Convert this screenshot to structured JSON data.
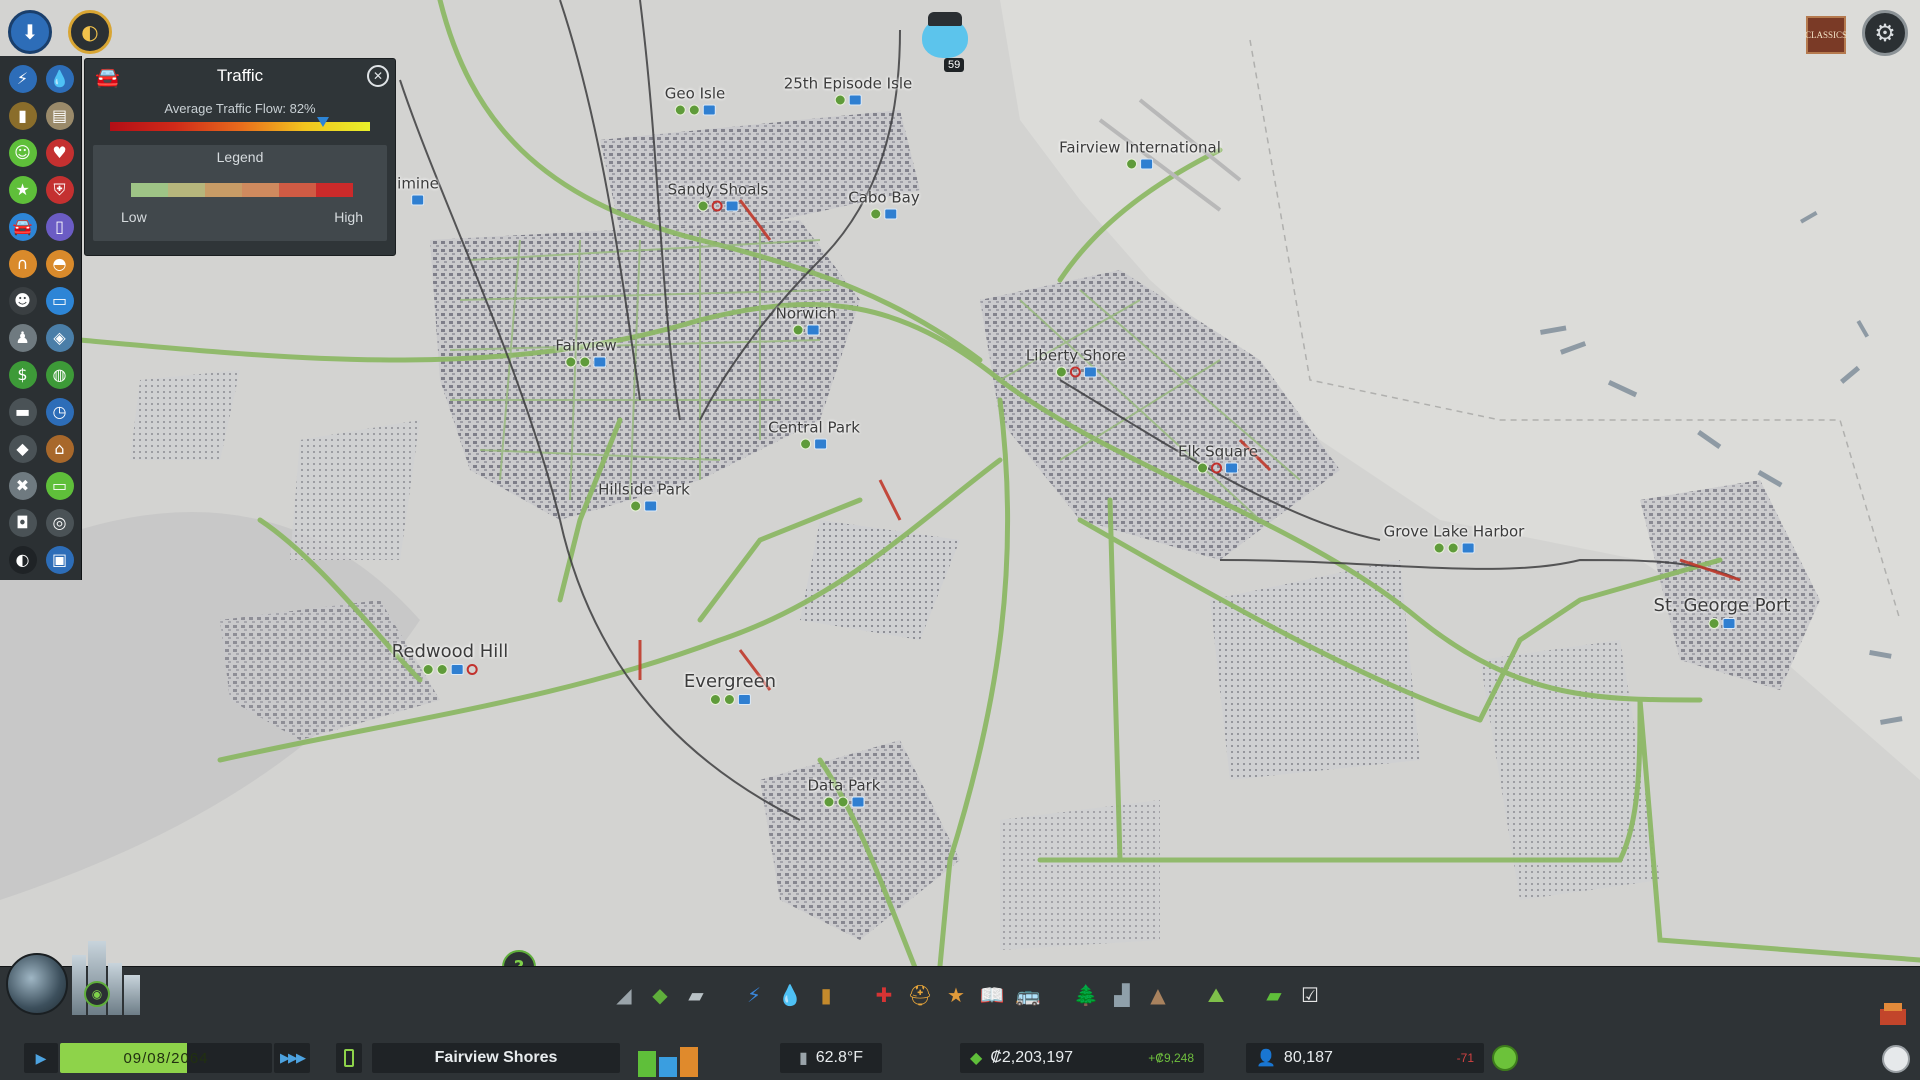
{
  "traffic_panel": {
    "title": "Traffic",
    "flow_label": "Average Traffic Flow: 82%",
    "flow_percent": 82,
    "legend_title": "Legend",
    "legend_low": "Low",
    "legend_high": "High",
    "legend_colors": [
      "#9ec486",
      "#b6b67c",
      "#c89c66",
      "#cf8a5e",
      "#d05b44",
      "#cc2a2a"
    ]
  },
  "chirper": {
    "count": "59"
  },
  "classics_label": "CLASSICS",
  "districts": [
    {
      "id": "geo-isle",
      "name": "Geo Isle"
    },
    {
      "id": "25th-episode-isle",
      "name": "25th Episode Isle"
    },
    {
      "id": "fairview-international",
      "name": "Fairview International"
    },
    {
      "id": "sandy-shoals",
      "name": "Sandy Shoals"
    },
    {
      "id": "cabo-bay",
      "name": "Cabo Bay"
    },
    {
      "id": "imine",
      "name": "imine"
    },
    {
      "id": "norwich",
      "name": "Norwich"
    },
    {
      "id": "fairview",
      "name": "Fairview"
    },
    {
      "id": "liberty-shore",
      "name": "Liberty Shore"
    },
    {
      "id": "central-park",
      "name": "Central Park"
    },
    {
      "id": "elk-square",
      "name": "Elk Square"
    },
    {
      "id": "hillside-park",
      "name": "Hillside Park"
    },
    {
      "id": "grove-lake-harbor",
      "name": "Grove Lake Harbor"
    },
    {
      "id": "st-george-port",
      "name": "St. George Port"
    },
    {
      "id": "redwood-hill",
      "name": "Redwood Hill"
    },
    {
      "id": "evergreen",
      "name": "Evergreen"
    },
    {
      "id": "data-park",
      "name": "Data Park"
    }
  ],
  "left_toolbar": [
    "electricity-icon",
    "water-icon",
    "garbage-icon",
    "education-icon",
    "happiness-icon",
    "health-icon",
    "attractiveness-icon",
    "fire-safety-icon",
    "traffic-icon",
    "wind-icon",
    "public-transport-icon",
    "fire-hazard-icon",
    "crime-icon",
    "transport-icon",
    "population-icon",
    "heating-icon",
    "economy-icon",
    "land-value-icon",
    "districts-icon",
    "outside-connections-icon",
    "natural-resources-icon",
    "tourism-icon",
    "maintenance-icon",
    "road-traffic-icon",
    "noise-icon",
    "pollution-icon",
    "zoning-icon",
    "radio-icon"
  ],
  "bottom": {
    "date": "09/08/2064",
    "city_name": "Fairview Shores",
    "temperature": "62.8°F",
    "money": "₡2,203,197",
    "money_delta": "+₡9,248",
    "population": "80,187",
    "population_delta": "-71"
  },
  "build_toolbar": [
    "roads-icon",
    "zoning-icon",
    "districts-icon",
    "electricity-icon",
    "water-icon",
    "garbage-icon",
    "healthcare-icon",
    "fire-department-icon",
    "police-icon",
    "education-icon",
    "public-transport-icon",
    "parks-icon",
    "unique-buildings-icon",
    "monuments-icon",
    "landscaping-icon",
    "money-icon",
    "policies-icon"
  ],
  "colors": {
    "panel": "#2f3538",
    "accent_green": "#8ed34a",
    "accent_blue": "#2d85d6",
    "road_green": "#8db866",
    "road_congested": "#c0392b"
  }
}
